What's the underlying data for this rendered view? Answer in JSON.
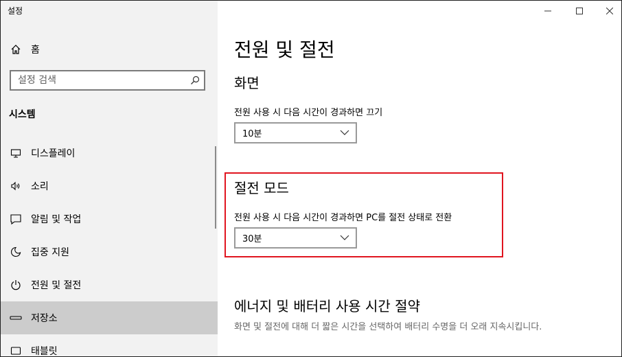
{
  "window": {
    "title": "설정"
  },
  "sidebar": {
    "home_label": "홈",
    "search_placeholder": "설정 검색",
    "section_title": "시스템",
    "items": [
      {
        "label": "디스플레이",
        "icon": "display-icon"
      },
      {
        "label": "소리",
        "icon": "speaker-icon"
      },
      {
        "label": "알림 및 작업",
        "icon": "notification-icon"
      },
      {
        "label": "집중 지원",
        "icon": "moon-icon"
      },
      {
        "label": "전원 및 절전",
        "icon": "power-icon"
      },
      {
        "label": "저장소",
        "icon": "storage-icon",
        "selected": true
      },
      {
        "label": "태블릿",
        "icon": "tablet-icon"
      }
    ]
  },
  "main": {
    "title": "전원 및 절전",
    "screen": {
      "heading": "화면",
      "label": "전원 사용 시 다음 시간이 경과하면 끄기",
      "value": "10분"
    },
    "sleep": {
      "heading": "절전 모드",
      "label": "전원 사용 시 다음 시간이 경과하면 PC를 절전 상태로 전환",
      "value": "30분"
    },
    "energy": {
      "heading": "에너지 및 배터리 사용 시간 절약",
      "description": "화면 및 절전에 대해 더 짧은 시간을 선택하여 배터리 수명을 더 오래 지속시킵니다."
    }
  },
  "colors": {
    "highlight_border": "#e0141f",
    "sidebar_bg": "#f2f2f2",
    "selected_bg": "#cccccc"
  }
}
